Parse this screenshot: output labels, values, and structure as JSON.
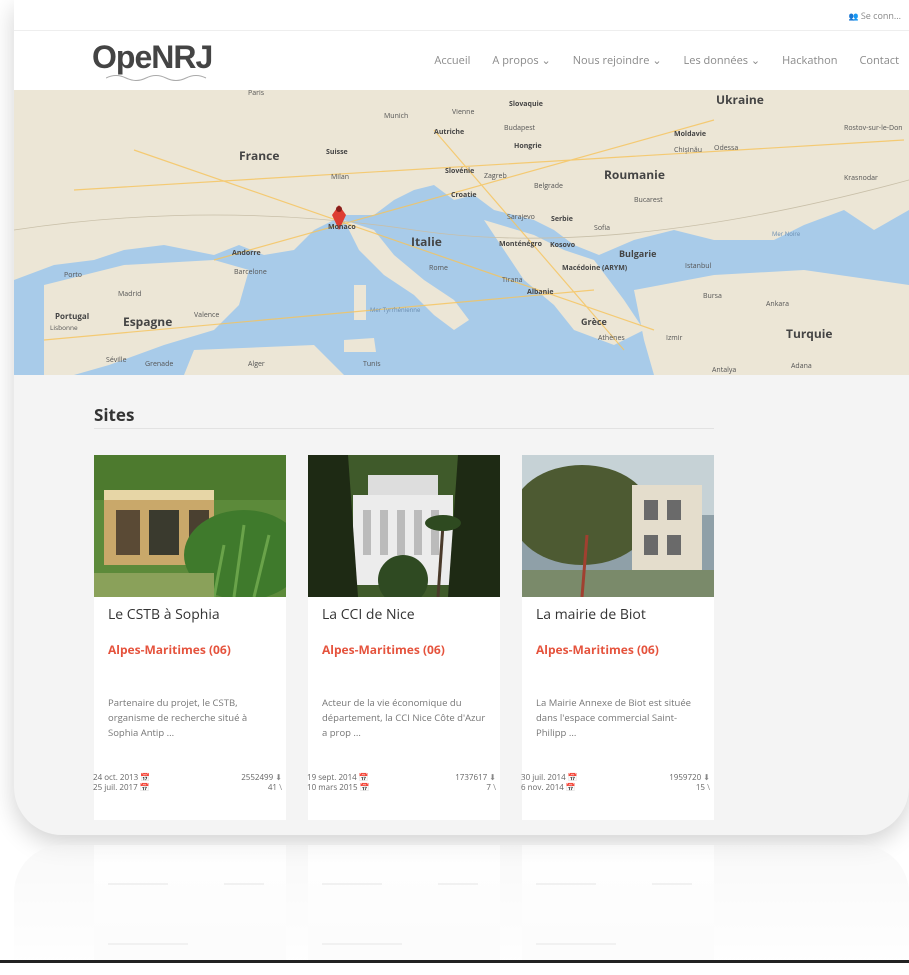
{
  "header": {
    "connect_label": "Se conn..."
  },
  "logo": {
    "text": "OpeNRJ"
  },
  "nav": {
    "items": [
      "Accueil",
      "A propos ⌄",
      "Nous rejoindre ⌄",
      "Les données ⌄",
      "Hackathon",
      "Contact"
    ]
  },
  "map": {
    "labels": [
      "Ukraine",
      "France",
      "Suisse",
      "Autriche",
      "Slovaquie",
      "Budapest",
      "Hongrie",
      "Moldavie",
      "Odessa",
      "Chișinău",
      "Roumanie",
      "Bucarest",
      "Rostov-sur-le-Don",
      "Krasnodar",
      "Paris",
      "Munich",
      "Vienne",
      "Milan",
      "Slovénie",
      "Zagreb",
      "Croatie",
      "Belgrade",
      "Sarajevo",
      "Serbie",
      "Sofia",
      "Monaco",
      "Italie",
      "Rome",
      "Monténégro",
      "Kosovo",
      "Bulgarie",
      "Macédoine (ARYM)",
      "Tirana",
      "Albanie",
      "Istanbul",
      "Bursa",
      "Ankara",
      "Turquie",
      "Grèce",
      "Athènes",
      "Izmir",
      "Antalya",
      "Adana",
      "Andorre",
      "Barcelone",
      "Porto",
      "Madrid",
      "Portugal",
      "Lisbonne",
      "Espagne",
      "Valence",
      "Séville",
      "Grenade",
      "Alger",
      "Tunis",
      "Mer Tyrrhénienne",
      "Mer Noire"
    ]
  },
  "sites": {
    "heading": "Sites",
    "cards": [
      {
        "title": "Le CSTB à Sophia",
        "dept": "Alpes-Maritimes (06)",
        "desc": "Partenaire du projet, le CSTB, organisme de recherche situé à Sophia Antip ...",
        "date1": "24 oct. 2013",
        "date2": "25 juil. 2017",
        "count1": "2552499",
        "count2": "41"
      },
      {
        "title": "La CCI de Nice",
        "dept": "Alpes-Maritimes (06)",
        "desc": "Acteur de la vie économique du département, la CCI Nice Côte d'Azur a prop ...",
        "date1": "19 sept. 2014",
        "date2": "10 mars 2015",
        "count1": "1737617",
        "count2": "7"
      },
      {
        "title": "La mairie de Biot",
        "dept": "Alpes-Maritimes (06)",
        "desc": "La Mairie Annexe de Biot est située dans l'espace commercial Saint-Philipp ...",
        "date1": "30 juil. 2014",
        "date2": "6 nov. 2014",
        "count1": "1959720",
        "count2": "15"
      }
    ]
  },
  "colors": {
    "accent": "#e5533d",
    "sea": "#a8cbe9",
    "land": "#ece6d6"
  }
}
